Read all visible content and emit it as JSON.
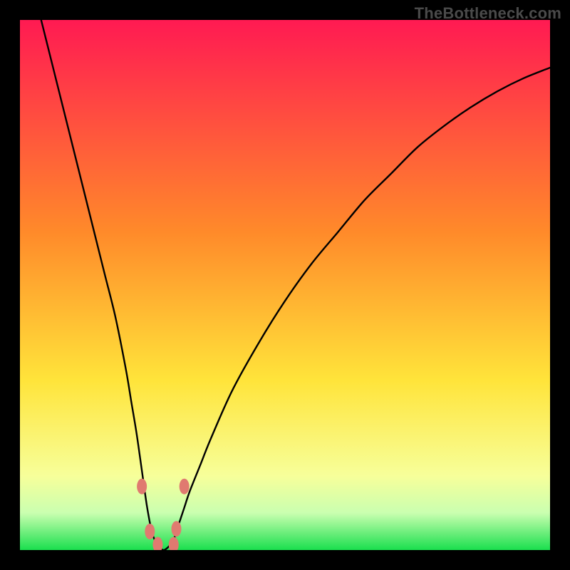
{
  "watermark": "TheBottleneck.com",
  "colors": {
    "bg": "#000000",
    "grad_top": "#ff1a52",
    "grad_mid1": "#ff8a2a",
    "grad_mid2": "#ffe43a",
    "grad_low": "#f7ff9a",
    "grad_band": "#caffb0",
    "grad_bottom": "#1adf4e",
    "curve": "#000000",
    "marker": "#e07a70"
  },
  "chart_data": {
    "type": "line",
    "title": "",
    "xlabel": "",
    "ylabel": "",
    "xlim": [
      0,
      100
    ],
    "ylim": [
      0,
      100
    ],
    "grid": false,
    "notch_x": 27,
    "series": [
      {
        "name": "bottleneck-curve",
        "x": [
          4,
          6,
          8,
          10,
          12,
          14,
          16,
          18,
          20,
          21,
          22,
          23,
          24,
          25,
          26,
          27,
          28,
          29,
          30,
          31,
          32,
          34,
          36,
          40,
          45,
          50,
          55,
          60,
          65,
          70,
          75,
          80,
          85,
          90,
          95,
          100
        ],
        "y": [
          100,
          92,
          84,
          76,
          68,
          60,
          52,
          44,
          34,
          28,
          22,
          15,
          8,
          3,
          1,
          0,
          0.6,
          2,
          5,
          8,
          11,
          16,
          21,
          30,
          39,
          47,
          54,
          60,
          66,
          71,
          76,
          80,
          83.5,
          86.5,
          89,
          91
        ]
      }
    ],
    "markers": [
      {
        "name": "marker-left-upper",
        "x": 23.0,
        "y": 12.0
      },
      {
        "name": "marker-left-lower",
        "x": 24.5,
        "y": 3.5
      },
      {
        "name": "marker-bottom-left",
        "x": 26.0,
        "y": 1.0
      },
      {
        "name": "marker-bottom-right",
        "x": 29.0,
        "y": 1.0
      },
      {
        "name": "marker-right-lower",
        "x": 29.5,
        "y": 4.0
      },
      {
        "name": "marker-right-upper",
        "x": 31.0,
        "y": 12.0
      }
    ]
  }
}
